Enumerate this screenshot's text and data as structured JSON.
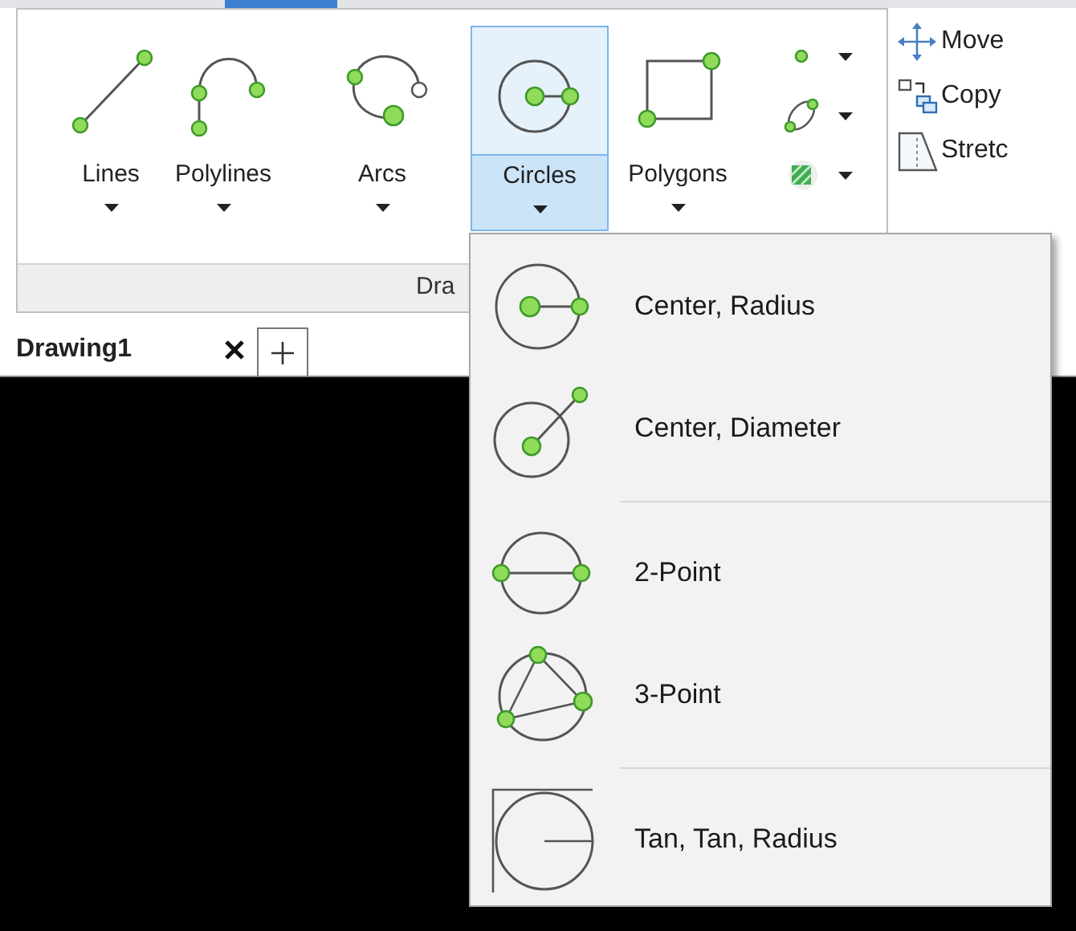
{
  "ribbon": {
    "draw_tools": [
      {
        "label": "Lines",
        "kind": "line",
        "selected": false
      },
      {
        "label": "Polylines",
        "kind": "polyline",
        "selected": false
      },
      {
        "label": "Arcs",
        "kind": "arc",
        "selected": false
      },
      {
        "label": "Circles",
        "kind": "circle",
        "selected": true
      },
      {
        "label": "Polygons",
        "kind": "rectangle",
        "selected": false
      }
    ],
    "panel_title": "Dra",
    "modify_tools": [
      {
        "label": "Move",
        "kind": "move"
      },
      {
        "label": "Copy",
        "kind": "copy"
      },
      {
        "label": "Stretc",
        "kind": "stretch"
      }
    ]
  },
  "document_tabs": [
    {
      "label": "Drawing1",
      "selected": true
    }
  ],
  "circles_menu": {
    "groups": [
      [
        {
          "label": "Center, Radius",
          "kind": "center-radius"
        },
        {
          "label": "Center, Diameter",
          "kind": "center-diameter"
        }
      ],
      [
        {
          "label": "2-Point",
          "kind": "two-point"
        },
        {
          "label": "3-Point",
          "kind": "three-point"
        }
      ],
      [
        {
          "label": "Tan, Tan, Radius",
          "kind": "tan-tan-radius"
        }
      ]
    ]
  }
}
